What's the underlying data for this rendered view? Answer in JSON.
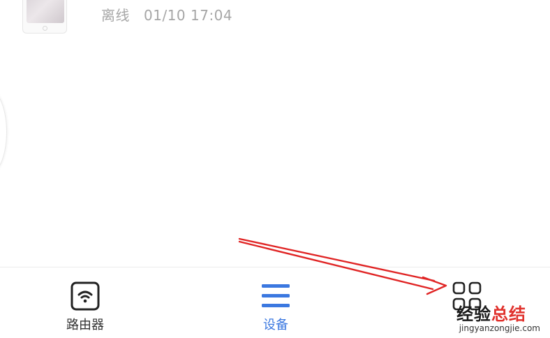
{
  "device": {
    "status": "离线",
    "timestamp": "01/10 17:04"
  },
  "tabbar": {
    "tabs": [
      {
        "label": "路由器",
        "icon": "wifi-icon",
        "active": false
      },
      {
        "label": "设备",
        "icon": "menu-lines-icon",
        "active": true
      },
      {
        "label": "",
        "icon": "grid-apps-icon",
        "active": false
      }
    ]
  },
  "watermark": {
    "title_part1": "经验",
    "title_part2": "总结",
    "url": "jingyanzongjie.com"
  },
  "colors": {
    "active_tab": "#3b78e0",
    "annotation_arrow": "#e02424",
    "status_text": "#a6a6a6"
  }
}
